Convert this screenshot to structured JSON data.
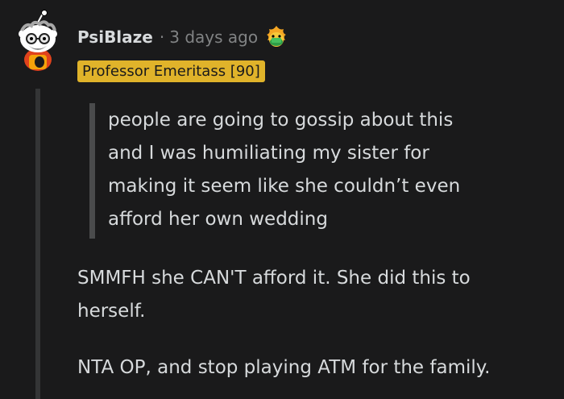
{
  "comment": {
    "username": "PsiBlaze",
    "separator": "·",
    "timestamp": "3 days ago",
    "award_icon": "hugz-award-icon",
    "avatar_icon": "snoo-avatar-icon",
    "flair": "Professor Emeritass [90]",
    "flair_color": "#e0b32a",
    "quote_lines": [
      "people are going to gossip about this",
      "and I was humiliating my sister for",
      "making it seem like she couldn’t even",
      "afford her own wedding"
    ],
    "paragraph_1_lines": [
      "SMMFH she CAN'T afford it. She did this to",
      "herself."
    ],
    "paragraph_2": "NTA OP, and stop playing ATM for the family."
  }
}
